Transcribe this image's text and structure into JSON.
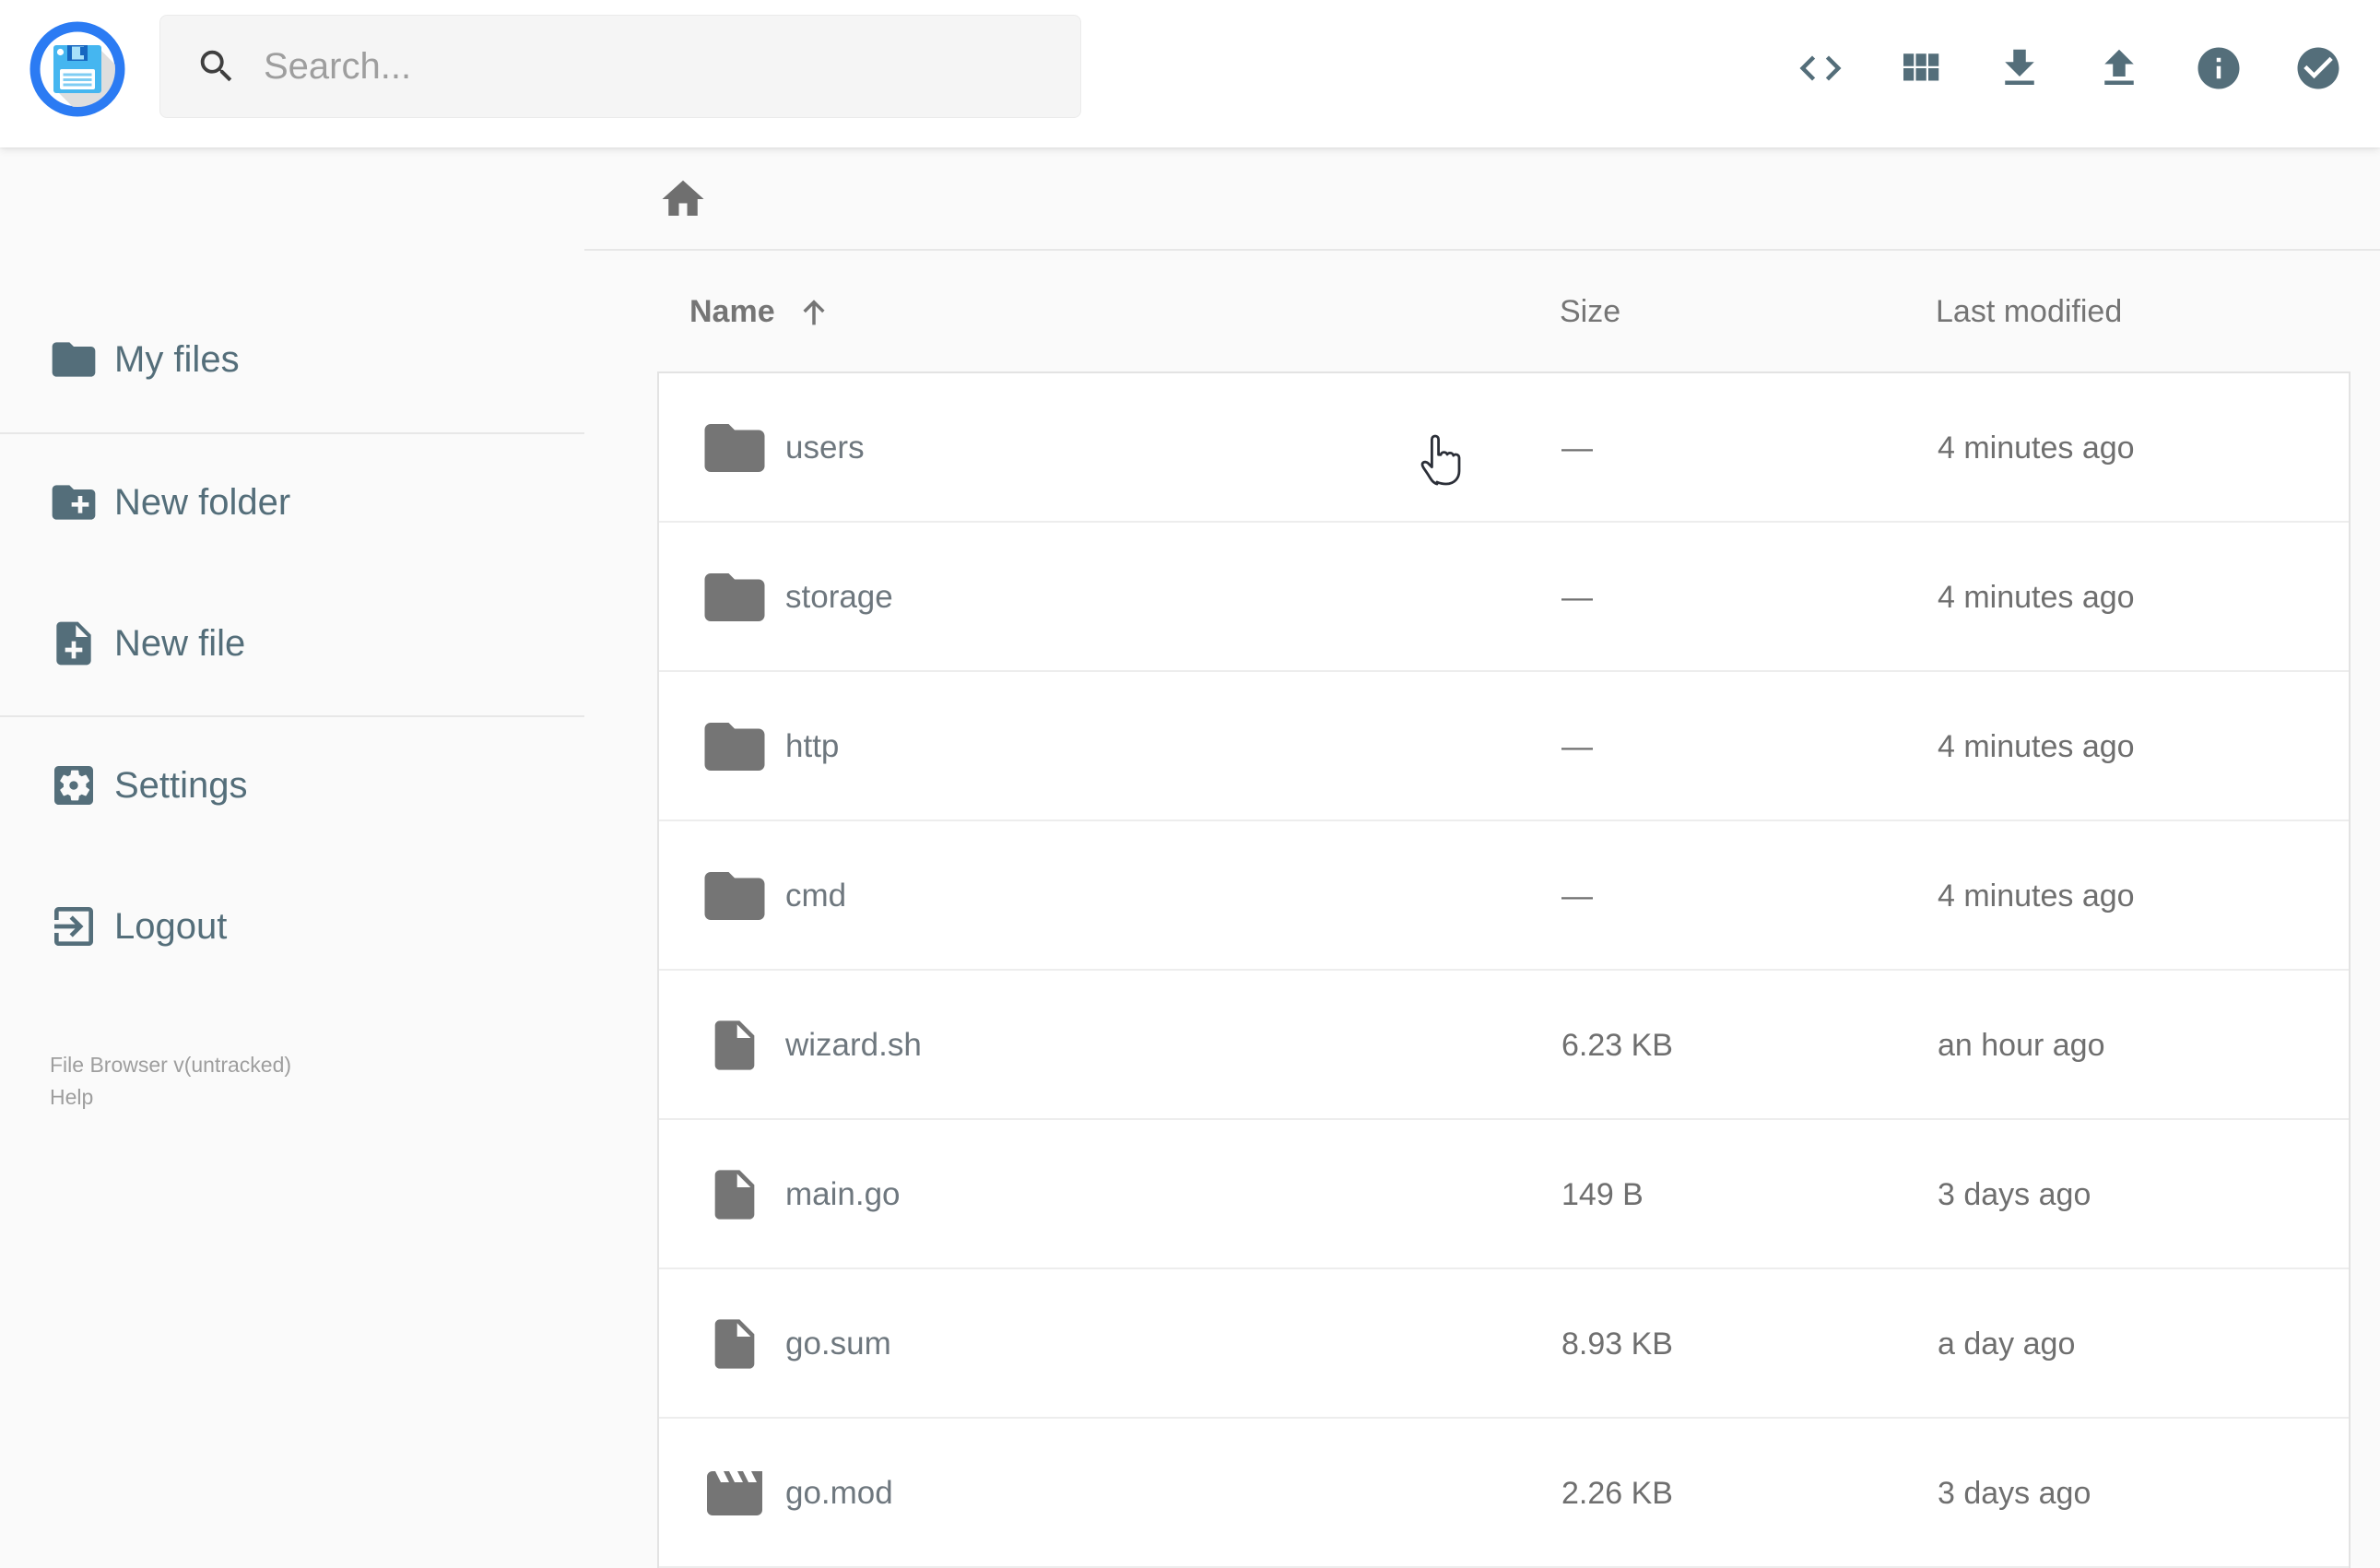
{
  "app": {
    "title": "File Browser"
  },
  "header": {
    "search": {
      "placeholder": "Search...",
      "value": ""
    },
    "icons": [
      "code-icon",
      "grid-view-icon",
      "download-icon",
      "upload-icon",
      "info-icon",
      "select-multiple-icon"
    ]
  },
  "sidebar": {
    "items": [
      {
        "label": "My files",
        "icon": "folder-icon"
      },
      {
        "label": "New folder",
        "icon": "folder-plus-icon"
      },
      {
        "label": "New file",
        "icon": "file-plus-icon"
      },
      {
        "label": "Settings",
        "icon": "settings-gear-icon"
      },
      {
        "label": "Logout",
        "icon": "logout-icon"
      }
    ],
    "version": "File Browser v(untracked)",
    "help": "Help"
  },
  "breadcrumb": {
    "home_icon": "home-icon"
  },
  "listing": {
    "columns": {
      "name": "Name",
      "size": "Size",
      "modified": "Last modified"
    },
    "sort": {
      "column": "Name",
      "direction": "ascending"
    },
    "rows": [
      {
        "name": "users",
        "type": "folder",
        "size": "—",
        "modified": "4 minutes ago"
      },
      {
        "name": "storage",
        "type": "folder",
        "size": "—",
        "modified": "4 minutes ago"
      },
      {
        "name": "http",
        "type": "folder",
        "size": "—",
        "modified": "4 minutes ago"
      },
      {
        "name": "cmd",
        "type": "folder",
        "size": "—",
        "modified": "4 minutes ago"
      },
      {
        "name": "wizard.sh",
        "type": "file",
        "size": "6.23 KB",
        "modified": "an hour ago"
      },
      {
        "name": "main.go",
        "type": "file",
        "size": "149 B",
        "modified": "3 days ago"
      },
      {
        "name": "go.sum",
        "type": "file",
        "size": "8.93 KB",
        "modified": "a day ago"
      },
      {
        "name": "go.mod",
        "type": "movie",
        "size": "2.26 KB",
        "modified": "3 days ago"
      }
    ]
  },
  "colors": {
    "accent_blue": "#2b7bf3",
    "floppy_blue": "#45b6f0",
    "slate": "#546e7a",
    "row_icon_gray": "#757575",
    "text_gray": "#6f6f6f",
    "page_bg": "#fafafa"
  },
  "cursor": {
    "type": "hand-pointer",
    "over": "users row"
  }
}
